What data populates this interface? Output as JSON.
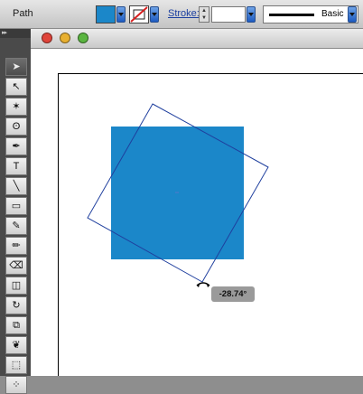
{
  "control_bar": {
    "selection_type": "Path",
    "fill_color": "#1b87c9",
    "stroke_label": "Stroke:",
    "stroke_weight": "",
    "brush_profile": "Basic"
  },
  "window": {
    "close_color": "#e0443a",
    "minimize_color": "#e8b030",
    "zoom_color": "#5ab540"
  },
  "tools": [
    {
      "name": "selection-tool-icon",
      "glyph": "➤"
    },
    {
      "name": "direct-selection-tool-icon",
      "glyph": "↖"
    },
    {
      "name": "magic-wand-tool-icon",
      "glyph": "✶"
    },
    {
      "name": "lasso-tool-icon",
      "glyph": "ʘ"
    },
    {
      "name": "pen-tool-icon",
      "glyph": "✒"
    },
    {
      "name": "type-tool-icon",
      "glyph": "T"
    },
    {
      "name": "line-segment-tool-icon",
      "glyph": "╲"
    },
    {
      "name": "rectangle-tool-icon",
      "glyph": "▭"
    },
    {
      "name": "paintbrush-tool-icon",
      "glyph": "✎"
    },
    {
      "name": "pencil-tool-icon",
      "glyph": "✏"
    },
    {
      "name": "blob-brush-tool-icon",
      "glyph": "⌫"
    },
    {
      "name": "eraser-tool-icon",
      "glyph": "◫"
    },
    {
      "name": "rotate-tool-icon",
      "glyph": "↻"
    },
    {
      "name": "scale-tool-icon",
      "glyph": "⧉"
    },
    {
      "name": "warp-tool-icon",
      "glyph": "❦"
    },
    {
      "name": "free-transform-tool-icon",
      "glyph": "⬚"
    },
    {
      "name": "symbol-sprayer-tool-icon",
      "glyph": "⁘"
    }
  ],
  "canvas": {
    "shape_fill": "#1b87c9",
    "rotation_bbox_color": "#1f3f9e",
    "rotation_angle": "-28.74°"
  }
}
